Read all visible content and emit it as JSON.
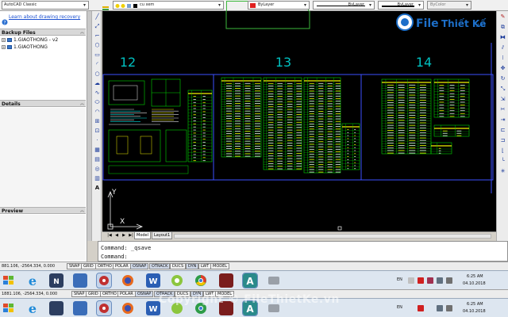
{
  "toolbar": {
    "workspace": "AutoCAD Classic",
    "layer_name": "cu xem",
    "color": "ByLayer",
    "linetype": "ByLayer",
    "lineweight": "ByLayer",
    "plotstyle": "ByColor"
  },
  "left_panel": {
    "recovery_link": "Learn about drawing recovery",
    "backup_header": "Backup Files",
    "backup_files": [
      "1.GIAOTHONG - v2",
      "1.GIAOTHONG"
    ],
    "details_header": "Details",
    "preview_header": "Preview"
  },
  "drawing": {
    "sheet_numbers": [
      "12",
      "13",
      "14"
    ],
    "ucs_x": "X",
    "ucs_y": "Y"
  },
  "layout_tabs": [
    "Model",
    "Layout1"
  ],
  "command": {
    "history": "Command:  _qsave",
    "prompt": "Command:"
  },
  "status_bar_1": {
    "coords": "881.106, -2564.334, 0.000",
    "buttons": [
      "SNAP",
      "GRID",
      "ORTHO",
      "POLAR",
      "OSNAP",
      "OTRACK",
      "DUCS",
      "DYN",
      "LWT",
      "MODEL"
    ]
  },
  "status_bar_2": {
    "coords": "1881.106, -2564.334, 0.000",
    "buttons": [
      "SNAP",
      "GRID",
      "ORTHO",
      "POLAR",
      "OSNAP",
      "OTRACK",
      "DUCS",
      "DYN",
      "LWT",
      "MODEL"
    ]
  },
  "taskbar_1": {
    "lang": "EN",
    "time": "6:25 AM",
    "date": "04.10.2018"
  },
  "taskbar_2": {
    "lang": "EN",
    "time": "6:25 AM",
    "date": "04.10.2018"
  },
  "watermark": {
    "logo_word1": "File",
    "logo_word2": "Thiết Kế",
    "logo_suffix": ".vn",
    "copyright": "Copyright © FileThietKe.vn"
  },
  "icons": {
    "draw_tools": [
      "line-icon",
      "construction-line-icon",
      "polyline-icon",
      "polygon-icon",
      "rectangle-icon",
      "arc-icon",
      "circle-icon",
      "revcloud-icon",
      "spline-icon",
      "ellipse-icon",
      "insert-block-icon",
      "make-block-icon",
      "point-icon",
      "hatch-icon",
      "region-icon",
      "table-icon",
      "mtext-icon"
    ],
    "modify_tools": [
      "erase-icon",
      "copy-icon",
      "mirror-icon",
      "offset-icon",
      "array-icon",
      "move-icon",
      "rotate-icon",
      "scale-icon",
      "stretch-icon",
      "trim-icon",
      "extend-icon",
      "break-icon",
      "join-icon",
      "chamfer-icon",
      "fillet-icon",
      "explode-icon"
    ]
  },
  "colors": {
    "canvas_bg": "#000000",
    "frame_blue": "#3c50ff",
    "table_green": "#00d600",
    "table_yellow": "#f2f200",
    "text_cyan": "#00e5e5",
    "logo_blue": "#1d6fc9"
  }
}
